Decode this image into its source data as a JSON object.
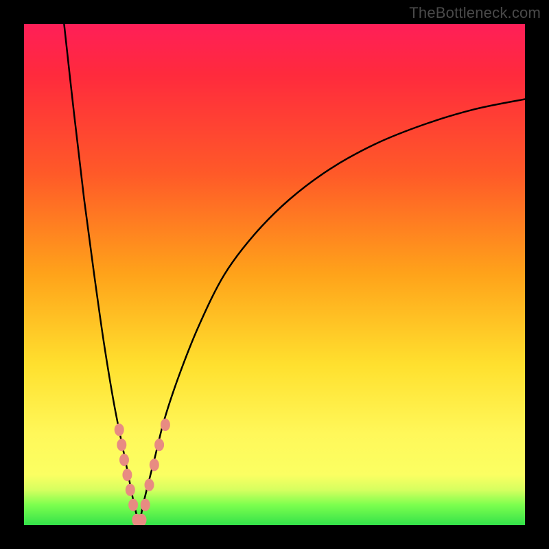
{
  "attribution": "TheBottleneck.com",
  "colors": {
    "frame": "#000000",
    "curve": "#000000",
    "marker": "#e88b82",
    "gradient_stops": [
      "#ff1f58",
      "#ff2a3d",
      "#ff5a28",
      "#ffa31a",
      "#ffe02e",
      "#fff85a",
      "#fbff62",
      "#d6ff60",
      "#7cff4e",
      "#34e24a"
    ]
  },
  "chart_data": {
    "type": "line",
    "title": "",
    "xlabel": "",
    "ylabel": "",
    "xlim": [
      0,
      100
    ],
    "ylim": [
      0,
      100
    ],
    "series": [
      {
        "name": "left-curve",
        "x": [
          8,
          10,
          12,
          14,
          16,
          18,
          20,
          21,
          22,
          23
        ],
        "y": [
          100,
          82,
          65,
          50,
          36,
          24,
          14,
          9,
          4,
          0
        ]
      },
      {
        "name": "right-curve",
        "x": [
          23,
          24,
          26,
          28,
          31,
          35,
          40,
          46,
          53,
          61,
          70,
          80,
          90,
          100
        ],
        "y": [
          0,
          5,
          13,
          21,
          30,
          40,
          50,
          58,
          65,
          71,
          76,
          80,
          83,
          85
        ]
      }
    ],
    "markers": [
      {
        "series": "left-curve",
        "x": 19.0,
        "y": 19
      },
      {
        "series": "left-curve",
        "x": 19.5,
        "y": 16
      },
      {
        "series": "left-curve",
        "x": 20.0,
        "y": 13
      },
      {
        "series": "left-curve",
        "x": 20.6,
        "y": 10
      },
      {
        "series": "left-curve",
        "x": 21.2,
        "y": 7
      },
      {
        "series": "left-curve",
        "x": 21.8,
        "y": 4
      },
      {
        "series": "left-curve",
        "x": 22.5,
        "y": 1
      },
      {
        "series": "right-curve",
        "x": 23.5,
        "y": 1
      },
      {
        "series": "right-curve",
        "x": 24.2,
        "y": 4
      },
      {
        "series": "right-curve",
        "x": 25.0,
        "y": 8
      },
      {
        "series": "right-curve",
        "x": 26.0,
        "y": 12
      },
      {
        "series": "right-curve",
        "x": 27.0,
        "y": 16
      },
      {
        "series": "right-curve",
        "x": 28.2,
        "y": 20
      }
    ],
    "grid": false,
    "legend": false
  }
}
